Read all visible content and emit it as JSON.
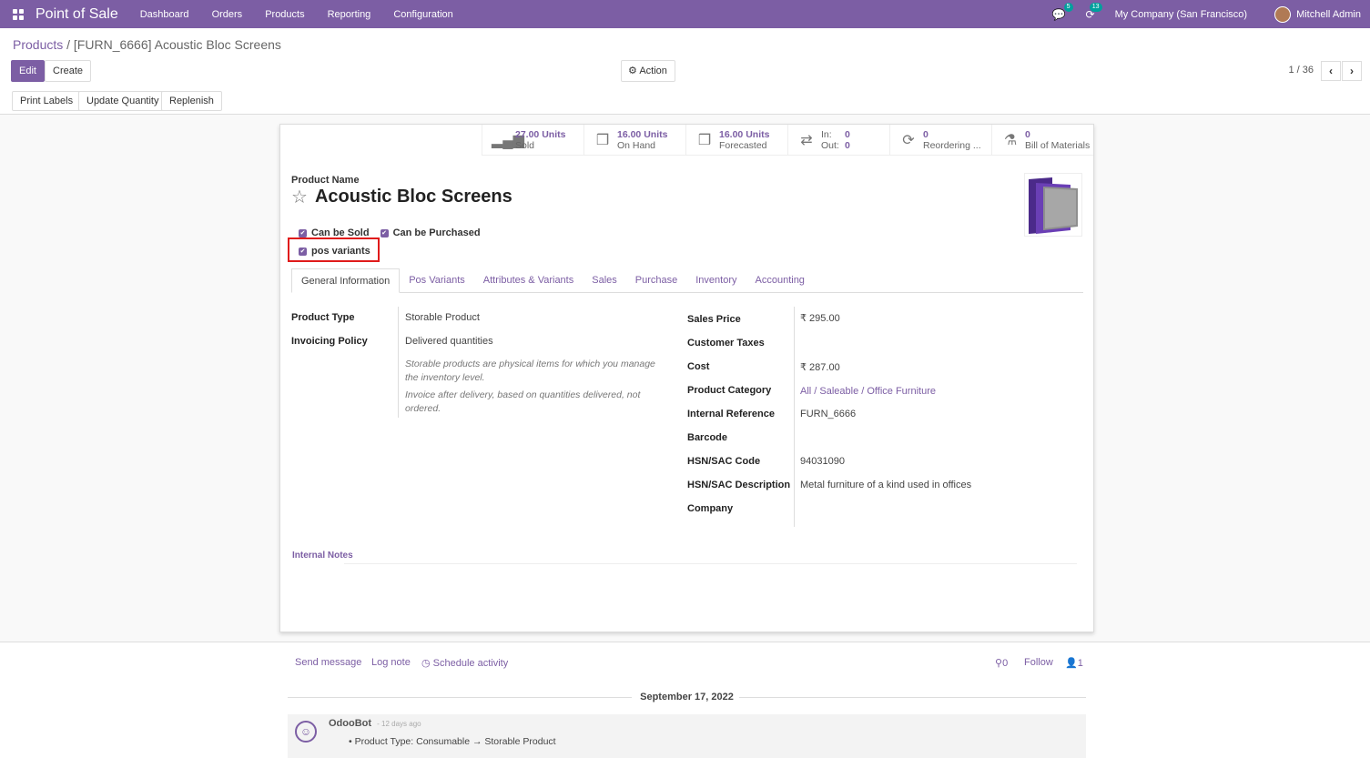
{
  "topbar": {
    "app_title": "Point of Sale",
    "nav": [
      "Dashboard",
      "Orders",
      "Products",
      "Reporting",
      "Configuration"
    ],
    "chat_badge": "5",
    "activity_badge": "13",
    "company": "My Company (San Francisco)",
    "user": "Mitchell Admin"
  },
  "breadcrumb": {
    "parent": "Products",
    "separator": "/",
    "current": "[FURN_6666] Acoustic Bloc Screens"
  },
  "buttons": {
    "edit": "Edit",
    "create": "Create",
    "action": "Action",
    "print_labels": "Print Labels",
    "update_quantity": "Update Quantity",
    "replenish": "Replenish"
  },
  "pager": {
    "text": "1 / 36"
  },
  "stats": {
    "sold_val": "27.00 Units",
    "sold_lbl": "Sold",
    "onhand_val": "16.00 Units",
    "onhand_lbl": "On Hand",
    "forecast_val": "16.00 Units",
    "forecast_lbl": "Forecasted",
    "in_lbl": "In:",
    "in_val": "0",
    "out_lbl": "Out:",
    "out_val": "0",
    "reorder_val": "0",
    "reorder_lbl": "Reordering ...",
    "bom_val": "0",
    "bom_lbl": "Bill of Materials"
  },
  "product": {
    "name_label": "Product Name",
    "name": "Acoustic Bloc Screens",
    "can_be_sold": "Can be Sold",
    "can_be_purchased": "Can be Purchased",
    "pos_variants": "pos variants"
  },
  "tabs": [
    "General Information",
    "Pos Variants",
    "Attributes & Variants",
    "Sales",
    "Purchase",
    "Inventory",
    "Accounting"
  ],
  "left_fields": {
    "product_type_lbl": "Product Type",
    "product_type_val": "Storable Product",
    "invoicing_lbl": "Invoicing Policy",
    "invoicing_val": "Delivered quantities",
    "help1": "Storable products are physical items for which you manage the inventory level.",
    "help2": "Invoice after delivery, based on quantities delivered, not ordered."
  },
  "right_fields": {
    "sales_price_lbl": "Sales Price",
    "sales_price_val": "₹ 295.00",
    "customer_taxes_lbl": "Customer Taxes",
    "cost_lbl": "Cost",
    "cost_val": "₹ 287.00",
    "category_lbl": "Product Category",
    "category_val": "All / Saleable / Office Furniture",
    "internal_ref_lbl": "Internal Reference",
    "internal_ref_val": "FURN_6666",
    "barcode_lbl": "Barcode",
    "hsn_code_lbl": "HSN/SAC Code",
    "hsn_code_val": "94031090",
    "hsn_desc_lbl": "HSN/SAC Description",
    "hsn_desc_val": "Metal furniture of a kind used in offices",
    "company_lbl": "Company"
  },
  "notes": {
    "label": "Internal Notes"
  },
  "chatter": {
    "send_message": "Send message",
    "log_note": "Log note",
    "schedule_activity": "Schedule activity",
    "attachments": "0",
    "follow": "Follow",
    "followers": "1",
    "date": "September 17, 2022",
    "author": "OdooBot",
    "time": "- 12 days ago",
    "body": "Product Type: Consumable → Storable Product"
  },
  "colors": {
    "brand": "#7c5ea4",
    "highlight": "#e01b1b"
  }
}
